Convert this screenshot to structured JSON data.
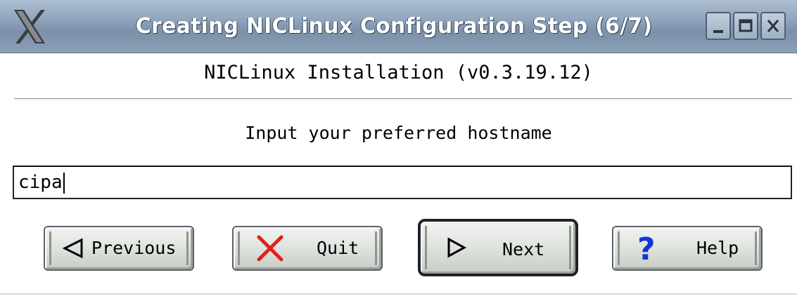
{
  "window": {
    "title": "Creating NICLinux Configuration Step (6/7)",
    "controls": {
      "minimize": "minimize-icon",
      "maximize": "maximize-icon",
      "close": "close-icon"
    },
    "logo": "x-logo-icon"
  },
  "heading": "NICLinux Installation (v0.3.19.12)",
  "prompt": "Input your preferred hostname",
  "hostname": {
    "value": "cipa"
  },
  "buttons": {
    "previous": {
      "label": "Previous",
      "icon": "left-triangle-icon"
    },
    "quit": {
      "label": "Quit",
      "icon": "red-x-icon",
      "icon_color": "#e0201c"
    },
    "next": {
      "label": "Next",
      "icon": "right-triangle-icon"
    },
    "help": {
      "label": "Help",
      "icon": "question-mark-icon",
      "icon_color": "#1433d6"
    }
  },
  "colors": {
    "titlebar": "#8ea3bb",
    "button_face": "#dfe3de"
  }
}
